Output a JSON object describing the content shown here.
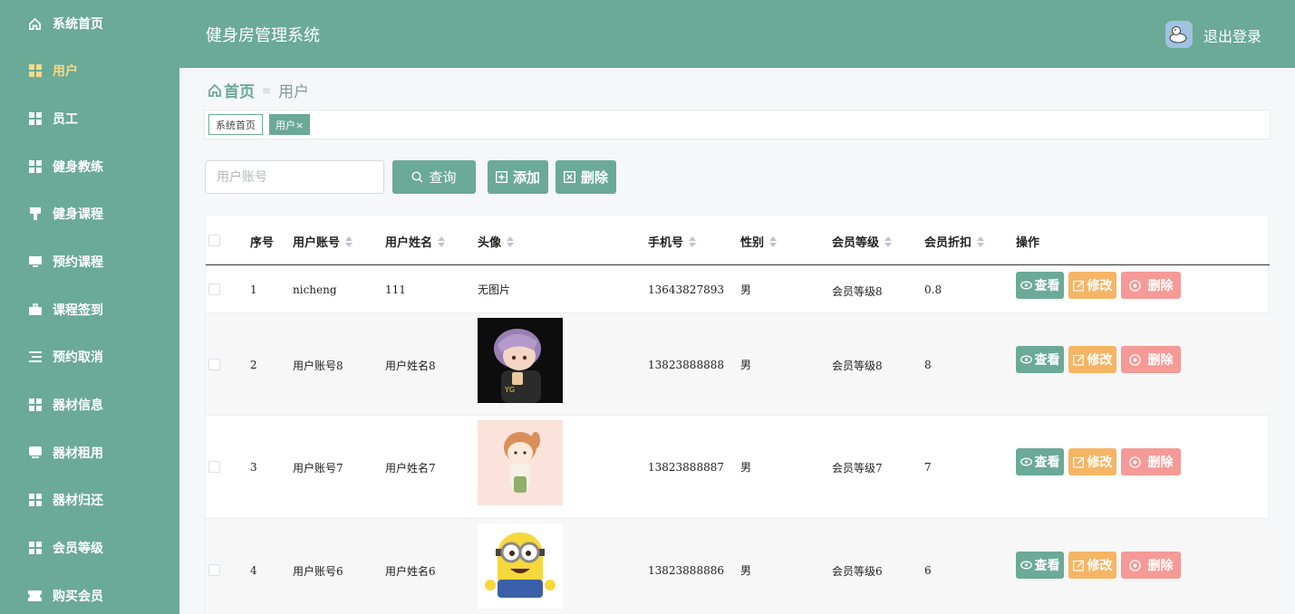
{
  "app": {
    "title": "健身房管理系统",
    "logout_label": "退出登录"
  },
  "sidebar": {
    "items": [
      {
        "label": "系统首页",
        "icon": "home-icon"
      },
      {
        "label": "用户",
        "icon": "grid-icon",
        "active": true
      },
      {
        "label": "员工",
        "icon": "grid-icon"
      },
      {
        "label": "健身教练",
        "icon": "grid-icon"
      },
      {
        "label": "健身课程",
        "icon": "stand-icon"
      },
      {
        "label": "预约课程",
        "icon": "monitor-icon"
      },
      {
        "label": "课程签到",
        "icon": "briefcase-icon"
      },
      {
        "label": "预约取消",
        "icon": "list-icon"
      },
      {
        "label": "器材信息",
        "icon": "grid-icon"
      },
      {
        "label": "器材租用",
        "icon": "chat-icon"
      },
      {
        "label": "器材归还",
        "icon": "grid-icon"
      },
      {
        "label": "会员等级",
        "icon": "grid-icon"
      },
      {
        "label": "购买会员",
        "icon": "ticket-icon"
      }
    ]
  },
  "breadcrumb": {
    "home": "首页",
    "separator": "≡",
    "current": "用户"
  },
  "tabs": {
    "home_label": "系统首页",
    "user_label": "用户×"
  },
  "toolbar": {
    "search_placeholder": "用户账号",
    "query_label": "查询",
    "add_label": "添加",
    "delete_label": "删除"
  },
  "table": {
    "headers": {
      "index": "序号",
      "account": "用户账号",
      "name": "用户姓名",
      "avatar": "头像",
      "phone": "手机号",
      "gender": "性别",
      "level": "会员等级",
      "discount": "会员折扣",
      "actions": "操作"
    },
    "rows": [
      {
        "index": "1",
        "account": "nicheng",
        "name": "111",
        "avatar_text": "无图片",
        "phone": "13643827893",
        "gender": "男",
        "level": "会员等级8",
        "discount": "0.8"
      },
      {
        "index": "2",
        "account": "用户账号8",
        "name": "用户姓名8",
        "avatar_text": "",
        "phone": "13823888888",
        "gender": "男",
        "level": "会员等级8",
        "discount": "8"
      },
      {
        "index": "3",
        "account": "用户账号7",
        "name": "用户姓名7",
        "avatar_text": "",
        "phone": "13823888887",
        "gender": "男",
        "level": "会员等级7",
        "discount": "7"
      },
      {
        "index": "4",
        "account": "用户账号6",
        "name": "用户姓名6",
        "avatar_text": "",
        "phone": "13823888886",
        "gender": "男",
        "level": "会员等级6",
        "discount": "6"
      }
    ],
    "actions": {
      "view": "查看",
      "edit": "修改",
      "delete": "删除"
    }
  },
  "colors": {
    "primary": "#6aaa96",
    "warning": "#f5b565",
    "danger": "#f59a96",
    "sidebar_active": "#f6d98a"
  }
}
